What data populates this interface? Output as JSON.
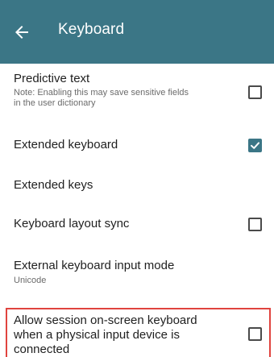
{
  "header": {
    "back_icon": "arrow-left-icon",
    "title": "Keyboard"
  },
  "settings": [
    {
      "label": "Predictive text",
      "note": "Note: Enabling this may save sensitive fields in the user dictionary",
      "note_line1": "Note: Enabling this may save sensitive fields",
      "note_line2": "in the user dictionary",
      "checked": false
    },
    {
      "label": "Extended keyboard",
      "checked": true
    },
    {
      "label": "Extended keys"
    },
    {
      "label": "Keyboard layout sync",
      "checked": false
    },
    {
      "label": "External keyboard input mode",
      "value": "Unicode"
    },
    {
      "label": "Allow session on-screen keyboard when a physical input device is connected",
      "label_line1": "Allow session on-screen keyboard",
      "label_line2": "when a physical input device is",
      "label_line3": "connected",
      "checked": false
    }
  ],
  "colors": {
    "appbar": "#3b7686",
    "checkbox_checked": "#3b7686",
    "highlight_border": "#e0433f"
  }
}
